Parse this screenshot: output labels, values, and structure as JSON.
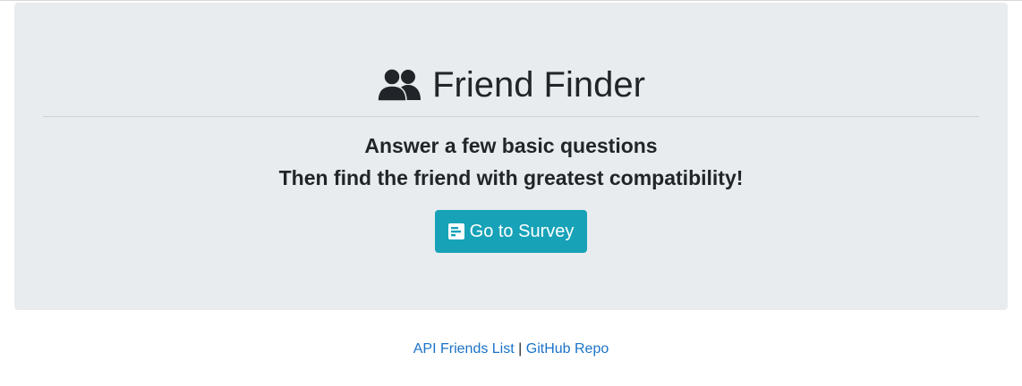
{
  "header": {
    "title": "Friend Finder",
    "title_icon": "users-icon"
  },
  "intro": {
    "line1": "Answer a few basic questions",
    "line2": "Then find the friend with greatest compatibility!"
  },
  "survey_button": {
    "label": "Go to Survey",
    "icon": "poll-icon"
  },
  "footer": {
    "links": [
      {
        "label": "API Friends List"
      },
      {
        "label": "GitHub Repo"
      }
    ],
    "separator": "|"
  },
  "colors": {
    "jumbotron_bg": "#e9ecef",
    "button_bg": "#17a2b8",
    "link": "#1a73c9",
    "text": "#212529"
  }
}
